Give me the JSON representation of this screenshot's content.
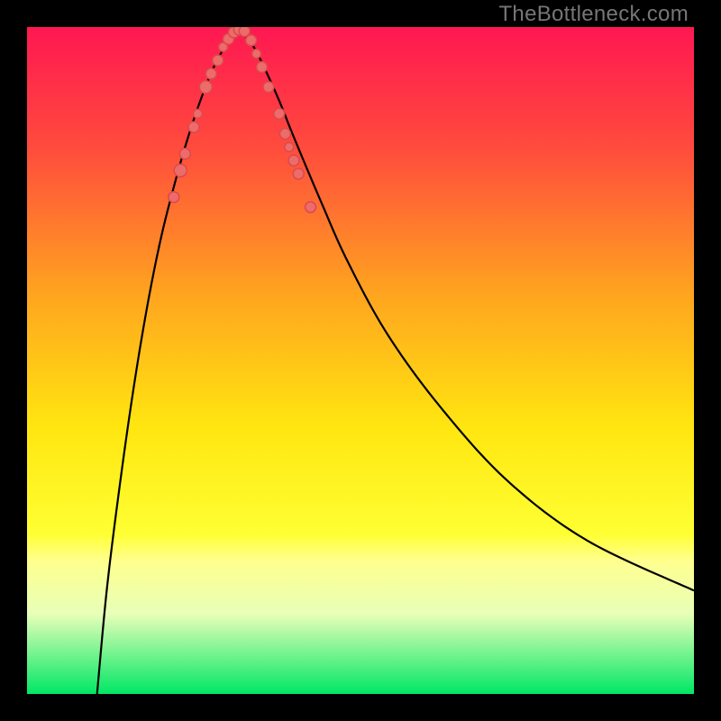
{
  "watermark": "TheBottleneck.com",
  "chart_data": {
    "type": "line",
    "title": "",
    "xlabel": "",
    "ylabel": "",
    "xlim": [
      0,
      100
    ],
    "ylim": [
      0,
      100
    ],
    "grid": false,
    "background": "rainbow_gradient",
    "gradient_stops": [
      {
        "pct": 0,
        "color": "#ff1752"
      },
      {
        "pct": 18,
        "color": "#ff4b3d"
      },
      {
        "pct": 40,
        "color": "#ffa41f"
      },
      {
        "pct": 60,
        "color": "#ffe610"
      },
      {
        "pct": 76,
        "color": "#ffff33"
      },
      {
        "pct": 80,
        "color": "#ffff8e"
      },
      {
        "pct": 88,
        "color": "#e8ffb8"
      },
      {
        "pct": 100,
        "color": "#00e765"
      }
    ],
    "curves": [
      {
        "name": "left",
        "points": [
          {
            "x": 10.5,
            "y": 0
          },
          {
            "x": 12,
            "y": 16
          },
          {
            "x": 14,
            "y": 32
          },
          {
            "x": 16,
            "y": 46
          },
          {
            "x": 18,
            "y": 58
          },
          {
            "x": 20,
            "y": 68
          },
          {
            "x": 22,
            "y": 76
          },
          {
            "x": 24,
            "y": 83
          },
          {
            "x": 26,
            "y": 89
          },
          {
            "x": 28,
            "y": 94
          },
          {
            "x": 30,
            "y": 97.5
          },
          {
            "x": 32,
            "y": 99.5
          }
        ]
      },
      {
        "name": "right",
        "points": [
          {
            "x": 32,
            "y": 99.5
          },
          {
            "x": 34,
            "y": 97
          },
          {
            "x": 36,
            "y": 93
          },
          {
            "x": 38,
            "y": 88.5
          },
          {
            "x": 40,
            "y": 83.5
          },
          {
            "x": 44,
            "y": 74
          },
          {
            "x": 48,
            "y": 65
          },
          {
            "x": 54,
            "y": 54
          },
          {
            "x": 62,
            "y": 43
          },
          {
            "x": 72,
            "y": 32
          },
          {
            "x": 84,
            "y": 23
          },
          {
            "x": 100,
            "y": 15.5
          }
        ]
      }
    ],
    "scatter": [
      {
        "x": 22.0,
        "y": 74.5,
        "r": 6
      },
      {
        "x": 23.0,
        "y": 78.5,
        "r": 7
      },
      {
        "x": 23.7,
        "y": 81.0,
        "r": 6
      },
      {
        "x": 25.0,
        "y": 85.0,
        "r": 6
      },
      {
        "x": 25.6,
        "y": 87.0,
        "r": 5
      },
      {
        "x": 26.8,
        "y": 91.0,
        "r": 7
      },
      {
        "x": 27.6,
        "y": 93.0,
        "r": 6
      },
      {
        "x": 28.6,
        "y": 95.0,
        "r": 6
      },
      {
        "x": 29.4,
        "y": 97.0,
        "r": 5
      },
      {
        "x": 30.2,
        "y": 98.2,
        "r": 6
      },
      {
        "x": 31.0,
        "y": 99.2,
        "r": 6
      },
      {
        "x": 31.8,
        "y": 99.6,
        "r": 6
      },
      {
        "x": 32.6,
        "y": 99.4,
        "r": 6
      },
      {
        "x": 33.6,
        "y": 98.0,
        "r": 6
      },
      {
        "x": 34.4,
        "y": 96.0,
        "r": 5
      },
      {
        "x": 35.2,
        "y": 94.0,
        "r": 6
      },
      {
        "x": 36.2,
        "y": 91.0,
        "r": 6
      },
      {
        "x": 37.8,
        "y": 87.0,
        "r": 6
      },
      {
        "x": 38.7,
        "y": 84.0,
        "r": 6
      },
      {
        "x": 39.3,
        "y": 82.0,
        "r": 5
      },
      {
        "x": 40.0,
        "y": 80.0,
        "r": 6
      },
      {
        "x": 40.7,
        "y": 78.0,
        "r": 6
      },
      {
        "x": 42.5,
        "y": 73.0,
        "r": 6
      }
    ]
  }
}
